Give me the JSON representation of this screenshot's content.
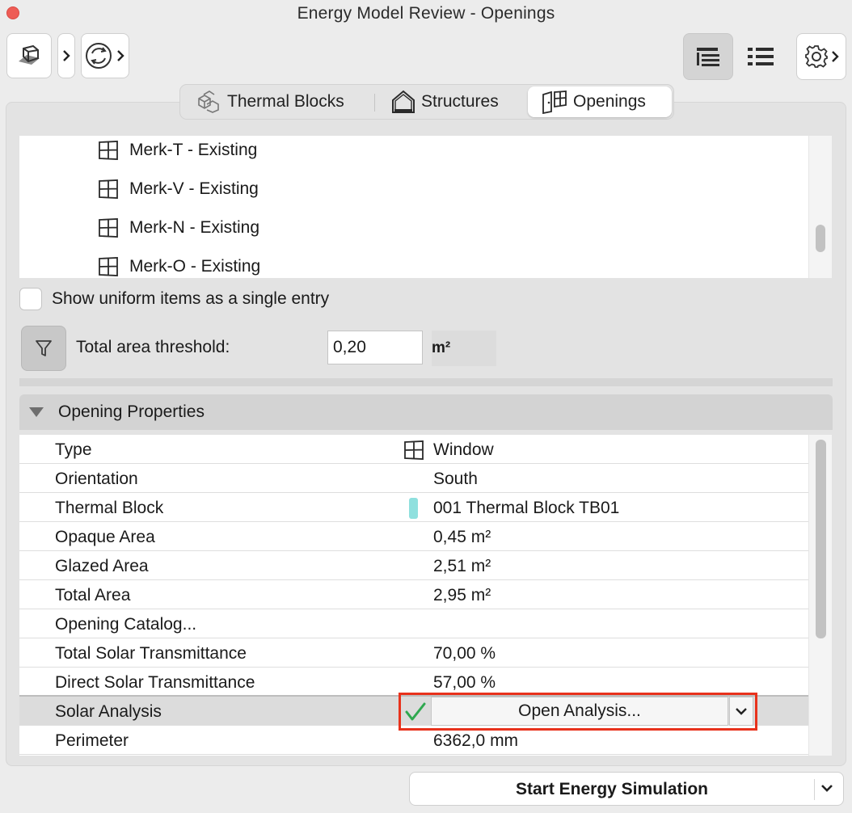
{
  "window": {
    "title": "Energy Model Review - Openings"
  },
  "toolbar": {
    "left_buttons": [
      "model-view-icon",
      "refresh-icon"
    ],
    "right_buttons": [
      "tree-list-icon",
      "flat-list-icon",
      "gear-icon"
    ]
  },
  "tabs": [
    {
      "label": "Thermal Blocks",
      "icon": "thermal-blocks-icon",
      "selected": false
    },
    {
      "label": "Structures",
      "icon": "structures-icon",
      "selected": false
    },
    {
      "label": "Openings",
      "icon": "openings-icon",
      "selected": true
    }
  ],
  "openings_list": [
    {
      "label": "Merk-T - Existing",
      "icon": "window-icon"
    },
    {
      "label": "Merk-V - Existing",
      "icon": "window-icon"
    },
    {
      "label": "Merk-N - Existing",
      "icon": "window-icon"
    },
    {
      "label": "Merk-O - Existing",
      "icon": "window-icon"
    }
  ],
  "uniform_checkbox": {
    "label": "Show uniform items as a single entry",
    "checked": false
  },
  "threshold": {
    "label": "Total area threshold:",
    "value": "0,20",
    "unit": "m²"
  },
  "properties": {
    "header": "Opening Properties",
    "rows": [
      {
        "name": "Type",
        "value": "Window",
        "icon": "window-icon"
      },
      {
        "name": "Orientation",
        "value": "South"
      },
      {
        "name": "Thermal Block",
        "value": "001 Thermal Block TB01",
        "swatch": "#8fe0de"
      },
      {
        "name": "Opaque Area",
        "value": "0,45 m²"
      },
      {
        "name": "Glazed Area",
        "value": "2,51 m²"
      },
      {
        "name": "Total Area",
        "value": "2,95 m²"
      },
      {
        "name": "Opening Catalog...",
        "value": ""
      },
      {
        "name": "Total Solar Transmittance",
        "value": "70,00 %"
      },
      {
        "name": "Direct Solar Transmittance",
        "value": "57,00 %"
      },
      {
        "name": "Solar Analysis",
        "value": ""
      },
      {
        "name": "Perimeter",
        "value": "6362,0 mm"
      }
    ],
    "solar_analysis_button": "Open Analysis...",
    "solar_analysis_checked": true
  },
  "start_button": {
    "label": "Start Energy Simulation"
  },
  "colors": {
    "highlight_frame": "#e8321c",
    "check_green": "#2fa84f",
    "thermal_swatch": "#8fe0de"
  }
}
